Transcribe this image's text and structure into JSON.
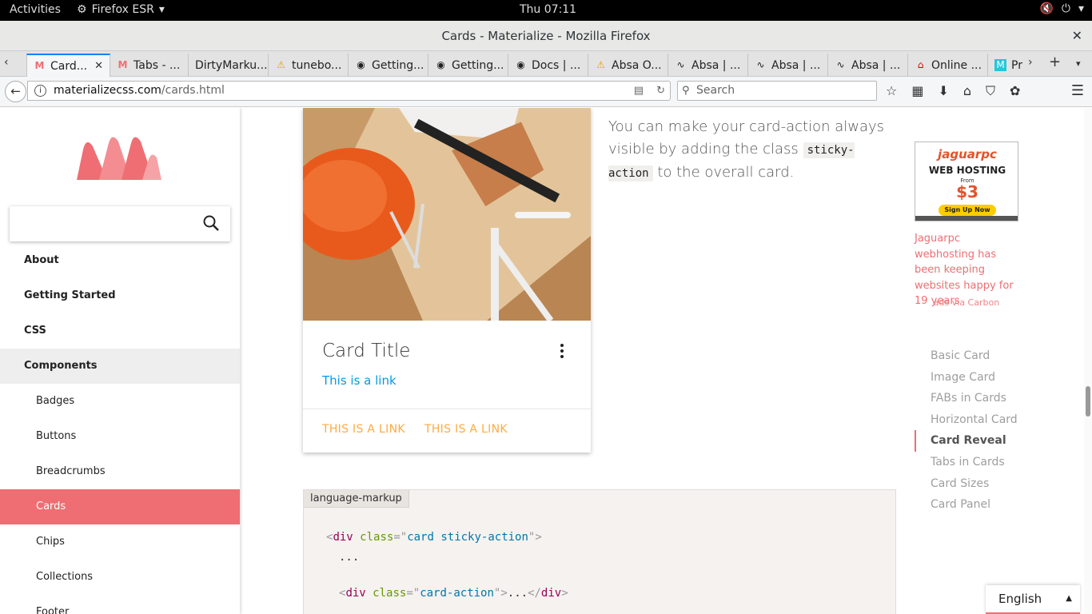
{
  "system": {
    "activities": "Activities",
    "app": "Firefox ESR",
    "clock": "Thu 07:11"
  },
  "window": {
    "title": "Cards - Materialize - Mozilla Firefox"
  },
  "tabs": [
    {
      "label": "Card..."
    },
    {
      "label": "Tabs - ..."
    },
    {
      "label": "DirtyMarku..."
    },
    {
      "label": "tunebo..."
    },
    {
      "label": "Getting..."
    },
    {
      "label": "Getting..."
    },
    {
      "label": "Docs | ..."
    },
    {
      "label": "Absa O..."
    },
    {
      "label": "Absa | ..."
    },
    {
      "label": "Absa | ..."
    },
    {
      "label": "Absa | ..."
    },
    {
      "label": "Online ..."
    },
    {
      "label": "Pr"
    }
  ],
  "navbar": {
    "url_domain": "materializecss.com",
    "url_path": "/cards.html",
    "search_placeholder": "Search"
  },
  "sidebar": {
    "items": [
      {
        "label": "About"
      },
      {
        "label": "Getting Started"
      },
      {
        "label": "CSS"
      },
      {
        "label": "Components"
      },
      {
        "label": "Badges"
      },
      {
        "label": "Buttons"
      },
      {
        "label": "Breadcrumbs"
      },
      {
        "label": "Cards"
      },
      {
        "label": "Chips"
      },
      {
        "label": "Collections"
      },
      {
        "label": "Footer"
      }
    ]
  },
  "card": {
    "title": "Card Title",
    "link": "This is a link",
    "action1": "THIS IS A LINK",
    "action2": "THIS IS A LINK"
  },
  "content": {
    "desc_1": "You can make your card-action always visible by adding the class",
    "desc_code": "sticky-action",
    "desc_2": "to the overall card."
  },
  "ad": {
    "brand": "jaguarpc",
    "headline": "WEB HOSTING",
    "from": "From",
    "price": "$3",
    "cta": "Sign Up Now",
    "text": "Jaguarpc webhosting has been keeping websites happy for 19 years",
    "carbon": "ads via Carbon"
  },
  "toc": [
    {
      "label": "Basic Card"
    },
    {
      "label": "Image Card"
    },
    {
      "label": "FABs in Cards"
    },
    {
      "label": "Horizontal Card"
    },
    {
      "label": "Card Reveal"
    },
    {
      "label": "Tabs in Cards"
    },
    {
      "label": "Card Sizes"
    },
    {
      "label": "Card Panel"
    }
  ],
  "code": {
    "lang": "language-markup",
    "line1_tag": "div",
    "line1_attr": "class",
    "line1_val": "card sticky-action",
    "line2": "...",
    "line3_tag": "div",
    "line3_attr": "class",
    "line3_val": "card-action",
    "line3_mid": "...",
    "line3_close": "div"
  },
  "language_select": {
    "value": "English"
  },
  "colors": {
    "accent": "#ee6e73",
    "link": "#039be5",
    "action": "#ffab40"
  }
}
